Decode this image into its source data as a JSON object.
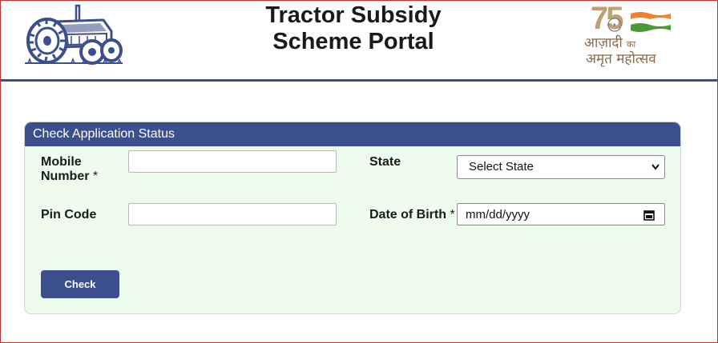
{
  "header": {
    "title_line1": "Tractor Subsidy",
    "title_line2": "Scheme Portal",
    "azadi_logo": {
      "number": "75",
      "line1_a": "आज़ादी",
      "line1_b": "का",
      "line2": "अमृत महोत्सव"
    },
    "tractor_logo_icon": "tractor-icon"
  },
  "form": {
    "heading": "Check Application Status",
    "mobile_label_1": "Mobile",
    "mobile_label_2": "Number",
    "required_mark": "*",
    "state_label": "State",
    "state_selected": "Select State",
    "pincode_label": "Pin Code",
    "dob_label": "Date of Birth",
    "dob_placeholder": "mm/dd/yyyy",
    "check_button": "Check"
  },
  "colors": {
    "accent": "#3b4f8c",
    "panel_bg": "#eefcee",
    "border_red": "#c9302c"
  }
}
